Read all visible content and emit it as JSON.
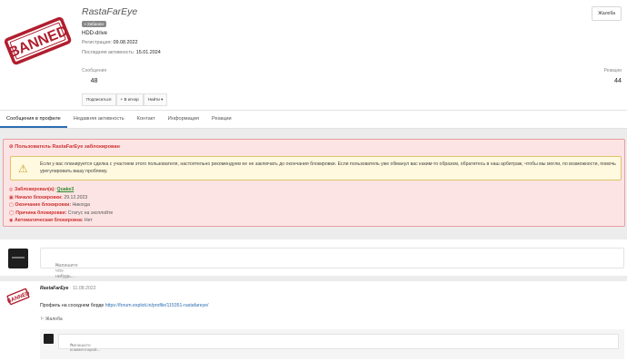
{
  "profile": {
    "username": "RastaFarEye",
    "banned_badge": "Забанен",
    "title": "HDD-drive",
    "registration_label": "Регистрация:",
    "registration_date": "09.08.2022",
    "last_activity_label": "Последняя активность:",
    "last_activity_date": "15.01.2024",
    "report_label": "Жалоба",
    "stats": {
      "messages_label": "Сообщения",
      "messages_value": "48",
      "reactions_label": "Реакции",
      "reactions_value": "44"
    },
    "buttons": [
      "Подписаться",
      "+ В игнор",
      "Найти ▾"
    ]
  },
  "tabs": [
    "Сообщения в профиле",
    "Недавняя активность",
    "Контакт",
    "Информация",
    "Реакции"
  ],
  "ban": {
    "header": "Пользователь RastaFarEye заблокирован",
    "note": "Если у вас планируется сделка с участием этого пользователя, настоятельно рекомендуем ее не заключать до окончания блокировки. Если пользователь уже обманул вас каким-то образом, обратитесь в наш арбитраж, чтобы мы могли, по возможности, помочь урегулировать вашу проблему.",
    "blocked_by_label": "Заблокировал(а):",
    "blocked_by": "Quake3",
    "start_label": "Начало блокировки:",
    "start": "29.12.2023",
    "end_label": "Окончание блокировки:",
    "end": "Никогда",
    "reason_label": "Причина блокировки:",
    "reason": "Статус на эксплойте",
    "auto_label": "Автоматическая блокировка:",
    "auto": "Нет"
  },
  "composer": {
    "placeholder": "Напишите что-нибудь..."
  },
  "post": {
    "author": "RastaFarEye",
    "date": "· 11.08.2022",
    "text": "Профиль на соседнем борде",
    "link": "https://forum.exploit.in/profile/115351-rastafareye/",
    "report": "Жалоба",
    "comment_placeholder": "Напишите комментарий..."
  },
  "stamp_text": "BANNED"
}
